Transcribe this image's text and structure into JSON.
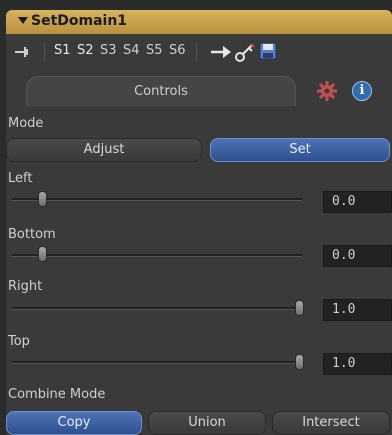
{
  "node": {
    "title": "SetDomain1"
  },
  "toolbar": {
    "scenes": [
      "S1",
      "S2",
      "S3",
      "S4",
      "S5",
      "S6"
    ],
    "active_scenes": [
      "S1",
      "S2"
    ]
  },
  "tabs": [
    {
      "label": "Controls",
      "icon": "controls-tab"
    },
    {
      "label": "",
      "icon": "gear-icon"
    },
    {
      "label": "",
      "icon": "info-icon",
      "glyph": "i"
    }
  ],
  "mode": {
    "label": "Mode",
    "options": [
      "Adjust",
      "Set"
    ],
    "selected": "Set"
  },
  "sliders": [
    {
      "label": "Left",
      "value": "0.0",
      "fraction": 0.0
    },
    {
      "label": "Bottom",
      "value": "0.0",
      "fraction": 0.0
    },
    {
      "label": "Right",
      "value": "1.0",
      "fraction": 1.0
    },
    {
      "label": "Top",
      "value": "1.0",
      "fraction": 1.0
    }
  ],
  "combine": {
    "label": "Combine Mode",
    "options": [
      "Copy",
      "Union",
      "Intersect"
    ],
    "selected": "Copy"
  },
  "colors": {
    "title_bar": "#c9a24d",
    "selected_button": "#3c5f9e",
    "panel": "#3a3a3a"
  }
}
